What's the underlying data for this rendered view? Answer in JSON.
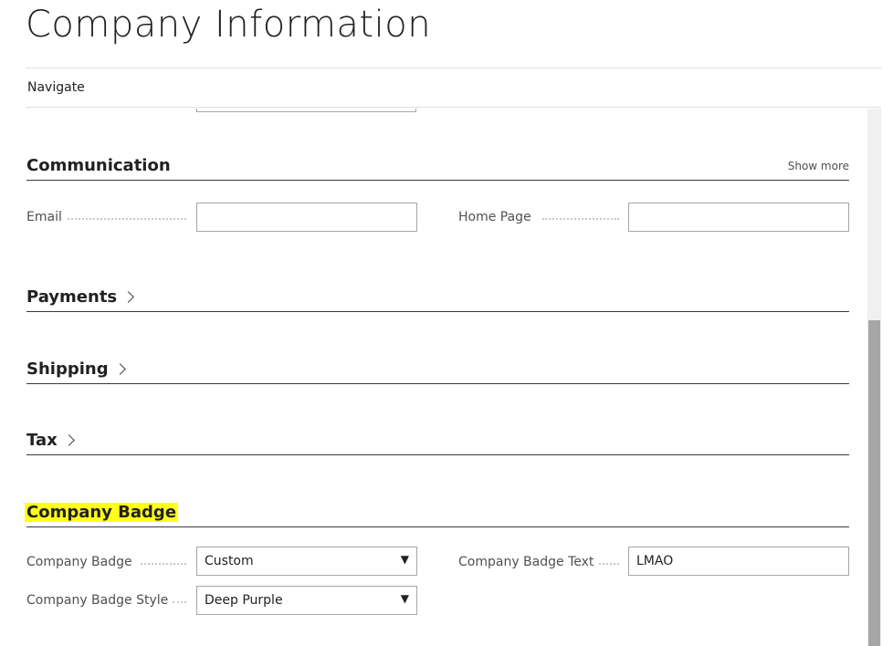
{
  "page": {
    "title": "Company Information"
  },
  "nav": {
    "label": "Navigate"
  },
  "communication": {
    "title": "Communication",
    "show_more": "Show more",
    "email_label": "Email",
    "email_value": "",
    "homepage_label": "Home Page",
    "homepage_value": ""
  },
  "payments": {
    "title": "Payments"
  },
  "shipping": {
    "title": "Shipping"
  },
  "tax": {
    "title": "Tax"
  },
  "badge": {
    "title": "Company Badge",
    "badge_label": "Company Badge",
    "badge_value": "Custom",
    "text_label": "Company Badge Text",
    "text_value": "LMAO",
    "style_label": "Company Badge Style",
    "style_value": "Deep Purple",
    "highlight_color": "#ffff1a"
  },
  "icons": {
    "dropdown": "chevron-down-icon",
    "expand": "chevron-right-icon"
  }
}
